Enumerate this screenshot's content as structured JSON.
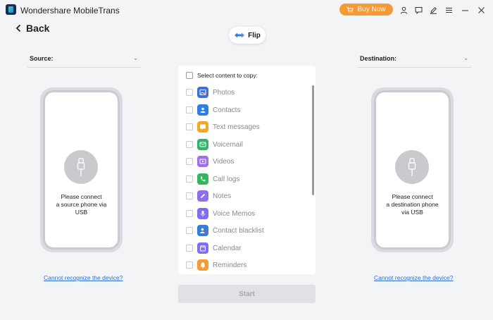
{
  "app": {
    "title": "Wondershare MobileTrans"
  },
  "titlebar": {
    "buy_now_label": "Buy Now"
  },
  "nav": {
    "back_label": "Back"
  },
  "flip": {
    "label": "Flip"
  },
  "source": {
    "label": "Source:",
    "message": "Please connect\na source phone via\nUSB",
    "help_link": "Cannot recognize the device?"
  },
  "destination": {
    "label": "Destination:",
    "message": "Please connect\na destination phone\nvia USB",
    "help_link": "Cannot recognize the device?"
  },
  "content": {
    "select_all_label": "Select content to copy:",
    "items": [
      {
        "label": "Photos",
        "icon": "photos-icon",
        "color": "#3d6fd9"
      },
      {
        "label": "Contacts",
        "icon": "contacts-icon",
        "color": "#2f7de1"
      },
      {
        "label": "Text messages",
        "icon": "messages-icon",
        "color": "#f5a623"
      },
      {
        "label": "Voicemail",
        "icon": "voicemail-icon",
        "color": "#35b36b"
      },
      {
        "label": "Videos",
        "icon": "videos-icon",
        "color": "#a56ce8"
      },
      {
        "label": "Call logs",
        "icon": "call-logs-icon",
        "color": "#33b65c"
      },
      {
        "label": "Notes",
        "icon": "notes-icon",
        "color": "#8f6cf0"
      },
      {
        "label": "Voice Memos",
        "icon": "voice-memos-icon",
        "color": "#7b6ef3"
      },
      {
        "label": "Contact blacklist",
        "icon": "contact-blacklist-icon",
        "color": "#2f7de1"
      },
      {
        "label": "Calendar",
        "icon": "calendar-icon",
        "color": "#7d6ff0"
      },
      {
        "label": "Reminders",
        "icon": "reminders-icon",
        "color": "#f59a34"
      }
    ]
  },
  "actions": {
    "start_label": "Start"
  }
}
